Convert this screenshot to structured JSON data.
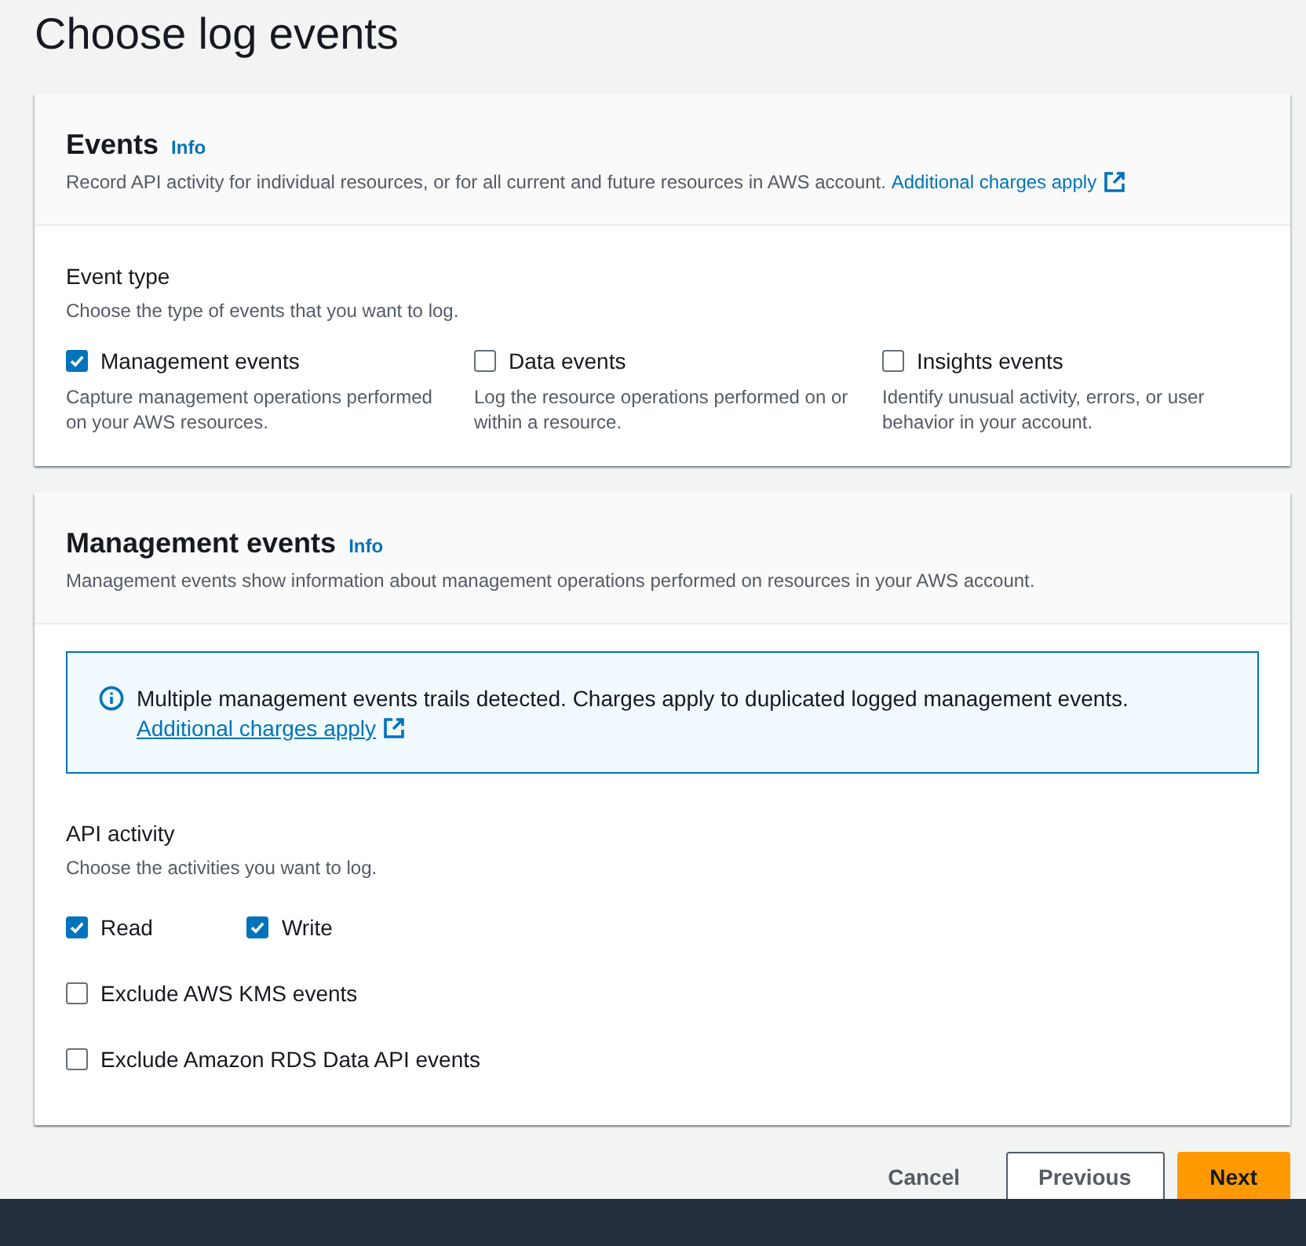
{
  "page_title": "Choose log events",
  "events_panel": {
    "title": "Events",
    "info": "Info",
    "description": "Record API activity for individual resources, or for all current and future resources in AWS account.",
    "link": "Additional charges apply",
    "event_type": {
      "label": "Event type",
      "description": "Choose the type of events that you want to log.",
      "options": [
        {
          "label": "Management events",
          "description": "Capture management operations performed on your AWS resources.",
          "checked": true
        },
        {
          "label": "Data events",
          "description": "Log the resource operations performed on or within a resource.",
          "checked": false
        },
        {
          "label": "Insights events",
          "description": "Identify unusual activity, errors, or user behavior in your account.",
          "checked": false
        }
      ]
    }
  },
  "management_panel": {
    "title": "Management events",
    "info": "Info",
    "description": "Management events show information about management operations performed on resources in your AWS account.",
    "alert": {
      "text": "Multiple management events trails detected. Charges apply to duplicated logged management events.",
      "link": "Additional charges apply"
    },
    "api_activity": {
      "label": "API activity",
      "description": "Choose the activities you want to log.",
      "options": [
        {
          "label": "Read",
          "checked": true
        },
        {
          "label": "Write",
          "checked": true
        }
      ]
    },
    "exclusions": [
      {
        "label": "Exclude AWS KMS events",
        "checked": false
      },
      {
        "label": "Exclude Amazon RDS Data API events",
        "checked": false
      }
    ]
  },
  "footer": {
    "buttons": [
      {
        "label": "Cancel",
        "kind": "link"
      },
      {
        "label": "Previous",
        "kind": "secondary"
      },
      {
        "label": "Next",
        "kind": "primary"
      }
    ]
  }
}
